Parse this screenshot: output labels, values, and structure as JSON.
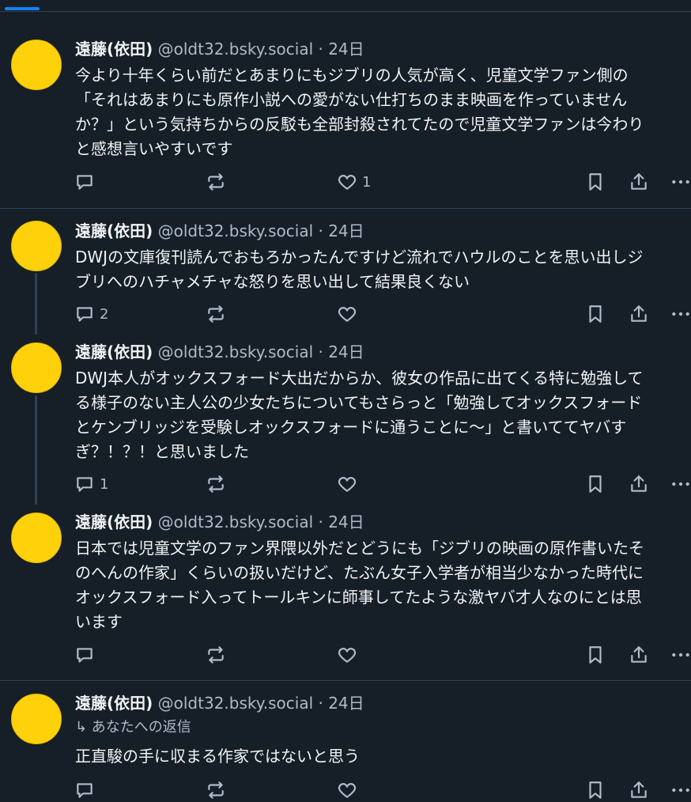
{
  "posts": [
    {
      "author": "遠藤(依田)",
      "handle": "@oldt32.bsky.social",
      "sep": "·",
      "time": "24日",
      "lines": [
        "今より十年くらい前だとあまりにもジブリの人気が高く、児童文学ファン側の",
        "「それはあまりにも原作小説への愛がない仕打ちのまま映画を作っていません",
        "か？」という気持ちからの反駁も全部封殺されてたので児童文学ファンは今わり",
        "と感想言いやすいです"
      ],
      "replies": "",
      "reposts": "",
      "likes": "1"
    },
    {
      "author": "遠藤(依田)",
      "handle": "@oldt32.bsky.social",
      "sep": "·",
      "time": "24日",
      "lines": [
        "DWJの文庫復刊読んでおもろかったんですけど流れでハウルのことを思い出しジ",
        "ブリへのハチャメチャな怒りを思い出して結果良くない"
      ],
      "replies": "2",
      "reposts": "",
      "likes": ""
    },
    {
      "author": "遠藤(依田)",
      "handle": "@oldt32.bsky.social",
      "sep": "·",
      "time": "24日",
      "lines": [
        "DWJ本人がオックスフォード大出だからか、彼女の作品に出てくる特に勉強して",
        "る様子のない主人公の少女たちについてもさらっと「勉強してオックスフォード",
        "とケンブリッジを受験しオックスフォードに通うことに〜」と書いててヤバす",
        "ぎ？！？！と思いました"
      ],
      "replies": "1",
      "reposts": "",
      "likes": ""
    },
    {
      "author": "遠藤(依田)",
      "handle": "@oldt32.bsky.social",
      "sep": "·",
      "time": "24日",
      "lines": [
        "日本では児童文学のファン界隈以外だとどうにも「ジブリの映画の原作書いたそ",
        "のへんの作家」くらいの扱いだけど、たぶん女子入学者が相当少なかった時代に",
        "オックスフォード入ってトールキンに師事してたような激ヤバ才人なのにとは思",
        "います"
      ],
      "replies": "",
      "reposts": "",
      "likes": ""
    },
    {
      "author": "遠藤(依田)",
      "handle": "@oldt32.bsky.social",
      "sep": "·",
      "time": "24日",
      "reply_to": "↳ あなたへの返信",
      "lines": [
        "正直駿の手に収まる作家ではないと思う"
      ],
      "replies": "",
      "reposts": "",
      "likes": ""
    }
  ],
  "icons": [
    "reply-icon",
    "repost-icon",
    "like-icon",
    "bookmark-icon",
    "share-icon",
    "more-icon"
  ],
  "colors": {
    "background": "#161e27",
    "avatar": "#ffd10a",
    "accent": "#1083fe",
    "muted": "#aebbc9"
  }
}
